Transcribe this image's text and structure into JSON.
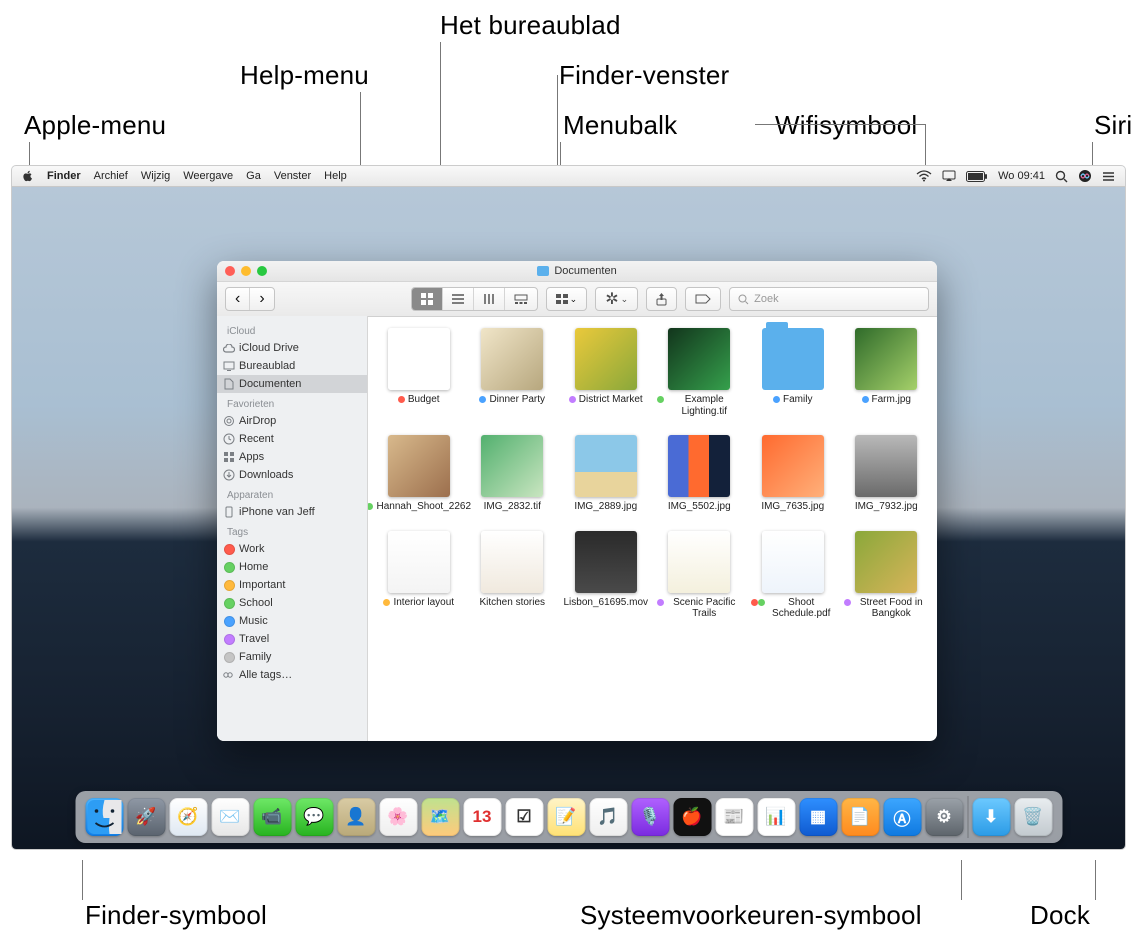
{
  "annotations": {
    "apple_menu": "Apple-menu",
    "help_menu": "Help-menu",
    "desktop": "Het bureaublad",
    "finder_window": "Finder-venster",
    "menubar": "Menubalk",
    "wifi": "Wifisymbool",
    "siri": "Siri",
    "finder_icon": "Finder-symbool",
    "sysprefs": "Systeemvoorkeuren-symbool",
    "dock": "Dock"
  },
  "menubar": {
    "items": [
      "Finder",
      "Archief",
      "Wijzig",
      "Weergave",
      "Ga",
      "Venster",
      "Help"
    ],
    "clock": "Wo 09:41"
  },
  "window": {
    "title": "Documenten",
    "search_placeholder": "Zoek",
    "sidebar": {
      "groups": [
        {
          "label": "iCloud",
          "items": [
            {
              "label": "iCloud Drive",
              "icon": "cloud"
            },
            {
              "label": "Bureaublad",
              "icon": "desktop"
            },
            {
              "label": "Documenten",
              "icon": "doc",
              "selected": true
            }
          ]
        },
        {
          "label": "Favorieten",
          "items": [
            {
              "label": "AirDrop",
              "icon": "airdrop"
            },
            {
              "label": "Recent",
              "icon": "clock"
            },
            {
              "label": "Apps",
              "icon": "apps"
            },
            {
              "label": "Downloads",
              "icon": "download"
            }
          ]
        },
        {
          "label": "Apparaten",
          "items": [
            {
              "label": "iPhone van Jeff",
              "icon": "phone"
            }
          ]
        },
        {
          "label": "Tags",
          "items": [
            {
              "label": "Work",
              "color": "#ff5b4c"
            },
            {
              "label": "Home",
              "color": "#66d162"
            },
            {
              "label": "Important",
              "color": "#ffb93c"
            },
            {
              "label": "School",
              "color": "#66d162"
            },
            {
              "label": "Music",
              "color": "#4aa2ff"
            },
            {
              "label": "Travel",
              "color": "#c27dff"
            },
            {
              "label": "Family",
              "color": "#c5c5c5"
            },
            {
              "label": "Alle tags…",
              "color": null
            }
          ]
        }
      ]
    },
    "files": [
      {
        "name": "Budget",
        "tag": "#ff5b4c",
        "bg": "linear-gradient(#fff,#fff)",
        "kind": "doc"
      },
      {
        "name": "Dinner Party",
        "tag": "#4aa2ff",
        "bg": "linear-gradient(135deg,#f0e5c8,#b7a77e)"
      },
      {
        "name": "District Market",
        "tag": "#c27dff",
        "bg": "linear-gradient(135deg,#eac93b,#8aa83a)"
      },
      {
        "name": "Example Lighting.tif",
        "tag": "#66d162",
        "bg": "linear-gradient(135deg,#12351c,#35a04c)"
      },
      {
        "name": "Family",
        "tag": "#4aa2ff",
        "bg": "#5bb0ec",
        "kind": "folder"
      },
      {
        "name": "Farm.jpg",
        "tag": "#4aa2ff",
        "bg": "linear-gradient(135deg,#2f6b2a,#a5d06a)"
      },
      {
        "name": "Hannah_Shoot_2262",
        "tag": "#66d162",
        "bg": "linear-gradient(135deg,#d8b98c,#9c6f4d)"
      },
      {
        "name": "IMG_2832.tif",
        "tag": null,
        "bg": "linear-gradient(135deg,#52b06e,#c9e5c0)"
      },
      {
        "name": "IMG_2889.jpg",
        "tag": null,
        "bg": "linear-gradient(#8cc8e8 60%,#e8d49c 60%)"
      },
      {
        "name": "IMG_5502.jpg",
        "tag": null,
        "bg": "linear-gradient(90deg,#4a6bd5 33%,#ff6a2f 33% 66%,#13213a 66%)"
      },
      {
        "name": "IMG_7635.jpg",
        "tag": null,
        "bg": "linear-gradient(135deg,#ff6a2f,#ffb07a)"
      },
      {
        "name": "IMG_7932.jpg",
        "tag": null,
        "bg": "linear-gradient(#b9b9b9,#6a6a6a)"
      },
      {
        "name": "Interior layout",
        "tag": "#ffb93c",
        "bg": "linear-gradient(#fff,#f4f4f4)"
      },
      {
        "name": "Kitchen stories",
        "tag": null,
        "bg": "linear-gradient(#fff,#f0e9de)"
      },
      {
        "name": "Lisbon_61695.mov",
        "tag": null,
        "bg": "linear-gradient(#2a2a2a,#4a4a4a)"
      },
      {
        "name": "Scenic Pacific Trails",
        "tag": "#c27dff",
        "bg": "linear-gradient(#fff,#f4f0dd)"
      },
      {
        "name": "Shoot Schedule.pdf",
        "tag2": "#66d162",
        "tag": "#ff5b4c",
        "bg": "linear-gradient(#fff,#eef4fb)"
      },
      {
        "name": "Street Food in Bangkok",
        "tag": "#c27dff",
        "bg": "linear-gradient(135deg,#8aa83a,#d8b45a)"
      }
    ]
  },
  "dock": {
    "apps": [
      {
        "name": "Finder",
        "bg": "linear-gradient(#4cb4ff,#1380e8)"
      },
      {
        "name": "Launchpad",
        "bg": "linear-gradient(#8f98a5,#5a636e)",
        "glyph": "🚀"
      },
      {
        "name": "Safari",
        "bg": "linear-gradient(#fff,#dfe8f2)",
        "glyph": "🧭"
      },
      {
        "name": "Mail",
        "bg": "linear-gradient(#fff,#e6e6e6)",
        "glyph": "✉️"
      },
      {
        "name": "FaceTime",
        "bg": "linear-gradient(#6ee867,#27b31f)",
        "glyph": "📹"
      },
      {
        "name": "Messages",
        "bg": "linear-gradient(#6ee867,#27b31f)",
        "glyph": "💬"
      },
      {
        "name": "Contacts",
        "bg": "linear-gradient(#d9cba4,#b9a979)",
        "glyph": "👤"
      },
      {
        "name": "Photos",
        "bg": "linear-gradient(#fff,#eee)",
        "glyph": "🌸"
      },
      {
        "name": "Maps",
        "bg": "linear-gradient(#bfe28f,#ffca7b)",
        "glyph": "🗺️"
      },
      {
        "name": "Calendar",
        "bg": "#fff",
        "glyph": "13",
        "text": "#e03030"
      },
      {
        "name": "Reminders",
        "bg": "#fff",
        "glyph": "☑︎",
        "text": "#333"
      },
      {
        "name": "Notes",
        "bg": "linear-gradient(#fff4c8,#ffe174)",
        "glyph": "📝"
      },
      {
        "name": "Music",
        "bg": "linear-gradient(#fff,#eee)",
        "glyph": "🎵",
        "text": "#ff2f5a"
      },
      {
        "name": "Podcasts",
        "bg": "linear-gradient(#b061ff,#7a2be0)",
        "glyph": "🎙️"
      },
      {
        "name": "TV",
        "bg": "#111",
        "glyph": "🍎"
      },
      {
        "name": "News",
        "bg": "#fff",
        "glyph": "📰",
        "text": "#ff3040"
      },
      {
        "name": "Numbers",
        "bg": "#fff",
        "glyph": "📊"
      },
      {
        "name": "Keynote",
        "bg": "linear-gradient(#2e8fff,#0f5ad0)",
        "glyph": "▦"
      },
      {
        "name": "Pages",
        "bg": "linear-gradient(#ffb646,#ff8a1e)",
        "glyph": "📄"
      },
      {
        "name": "App Store",
        "bg": "linear-gradient(#3ca6ff,#0f79e0)",
        "glyph": "Ⓐ"
      },
      {
        "name": "Systeemvoorkeuren",
        "bg": "linear-gradient(#9aa1a8,#5d646b)",
        "glyph": "⚙︎"
      }
    ],
    "right": [
      {
        "name": "Downloads",
        "bg": "linear-gradient(#6cc9ff,#2b9be6)",
        "glyph": "⬇︎"
      },
      {
        "name": "Prullenmand",
        "bg": "linear-gradient(#e9edf0,#c3cacf)",
        "glyph": "🗑️"
      }
    ]
  }
}
